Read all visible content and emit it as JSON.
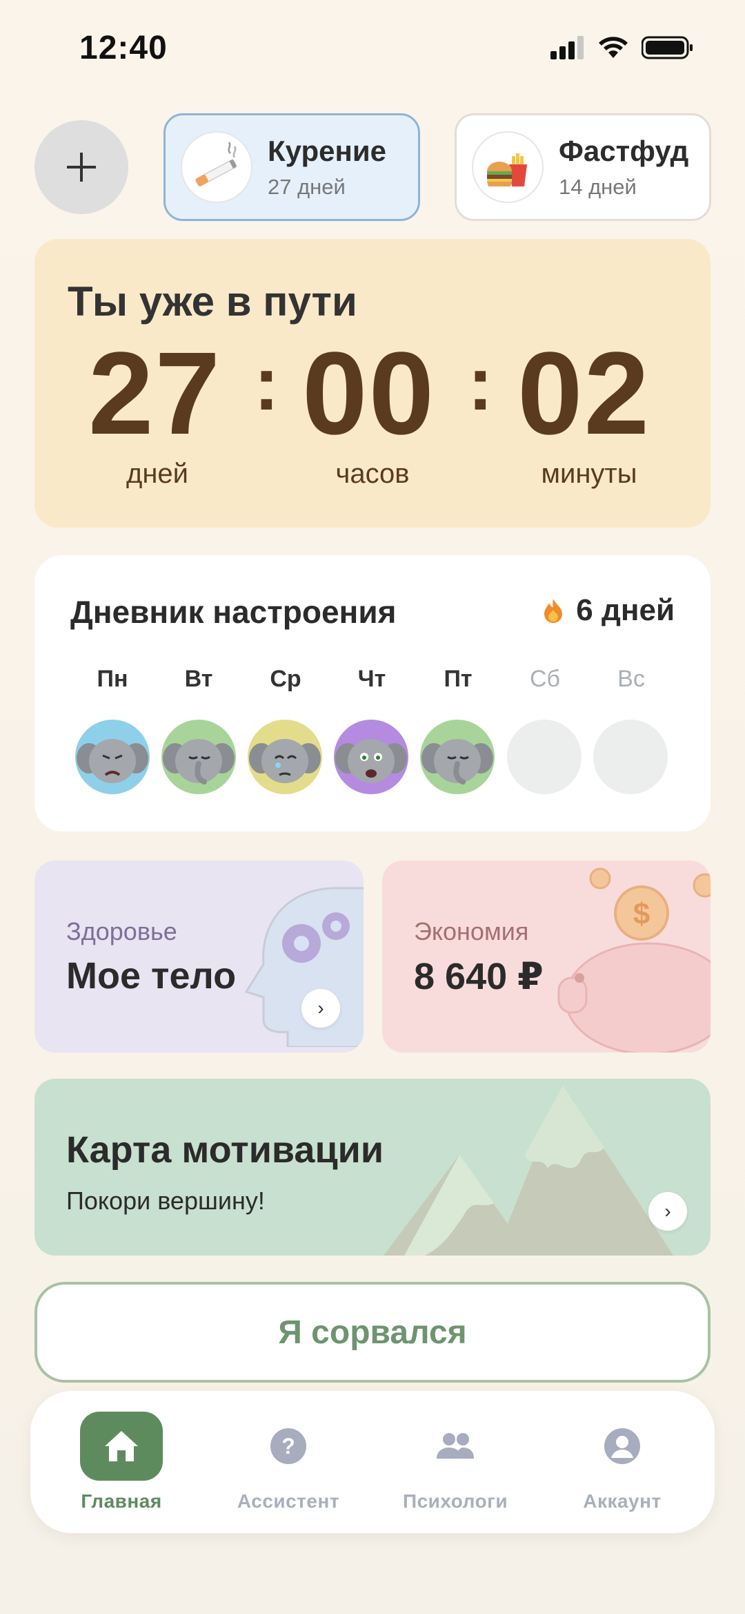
{
  "status_bar": {
    "time": "12:40"
  },
  "habits": [
    {
      "name": "Курение",
      "days": "27 дней",
      "icon": "cigarette-icon",
      "active": true
    },
    {
      "name": "Фастфуд",
      "days": "14 дней",
      "icon": "fastfood-icon",
      "active": false
    }
  ],
  "timer": {
    "title": "Ты уже в пути",
    "days": "27",
    "hours": "00",
    "minutes": "02",
    "days_label": "дней",
    "hours_label": "часов",
    "minutes_label": "минуты",
    "separator": ":"
  },
  "mood_diary": {
    "title": "Дневник настроения",
    "streak": "6 дней",
    "days": [
      {
        "label": "Пн",
        "mood": "sad",
        "bg": "#8ed0ea"
      },
      {
        "label": "Вт",
        "mood": "calm",
        "bg": "#a8d49a"
      },
      {
        "label": "Ср",
        "mood": "crying",
        "bg": "#e3dc8a"
      },
      {
        "label": "Чт",
        "mood": "scared",
        "bg": "#b48be0"
      },
      {
        "label": "Пт",
        "mood": "calm",
        "bg": "#a8d49a"
      },
      {
        "label": "Сб",
        "mood": "empty",
        "bg": "#eceded"
      },
      {
        "label": "Вс",
        "mood": "empty",
        "bg": "#eceded"
      }
    ]
  },
  "health_card": {
    "label": "Здоровье",
    "value": "Мое тело",
    "label_color": "#7d6f98"
  },
  "economy_card": {
    "label": "Экономия",
    "value": "8 640 ₽",
    "label_color": "#a86e6e"
  },
  "motivation_card": {
    "title": "Карта мотивации",
    "subtitle": "Покори вершину!"
  },
  "relapse_button": {
    "label": "Я сорвался"
  },
  "tabbar": {
    "tabs": [
      {
        "label": "Главная",
        "icon": "home-icon",
        "active": true
      },
      {
        "label": "Ассистент",
        "icon": "question-icon",
        "active": false
      },
      {
        "label": "Психологи",
        "icon": "people-icon",
        "active": false
      },
      {
        "label": "Аккаунт",
        "icon": "account-icon",
        "active": false
      }
    ]
  },
  "colors": {
    "accent_green": "#5e8b5e",
    "timer_bg": "#fae9c8",
    "timer_text": "#5a3b1f",
    "habit_active_bg": "#e6f0fb"
  }
}
